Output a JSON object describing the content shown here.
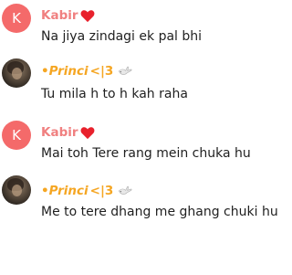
{
  "messages": [
    {
      "avatar_letter": "K",
      "sender": "Kabir",
      "sender_suffix": "",
      "badge_icon": "heart-icon",
      "text": "Na jiya zindagi ek pal bhi"
    },
    {
      "avatar_letter": "",
      "sender": "•Princi",
      "sender_suffix": "<|3",
      "badge_icon": "dove-icon",
      "text": "Tu mila h to h kah raha"
    },
    {
      "avatar_letter": "K",
      "sender": "Kabir",
      "sender_suffix": "",
      "badge_icon": "heart-icon",
      "text": "Mai toh Tere rang mein chuka hu"
    },
    {
      "avatar_letter": "",
      "sender": "•Princi",
      "sender_suffix": "<|3",
      "badge_icon": "dove-icon",
      "text": "Me to tere dhang me ghang chuki hu"
    }
  ],
  "colors": {
    "kabir_name": "#f08080",
    "princi_name": "#f5a623",
    "avatar_bg": "#f46a6a",
    "heart": "#e8212c"
  }
}
